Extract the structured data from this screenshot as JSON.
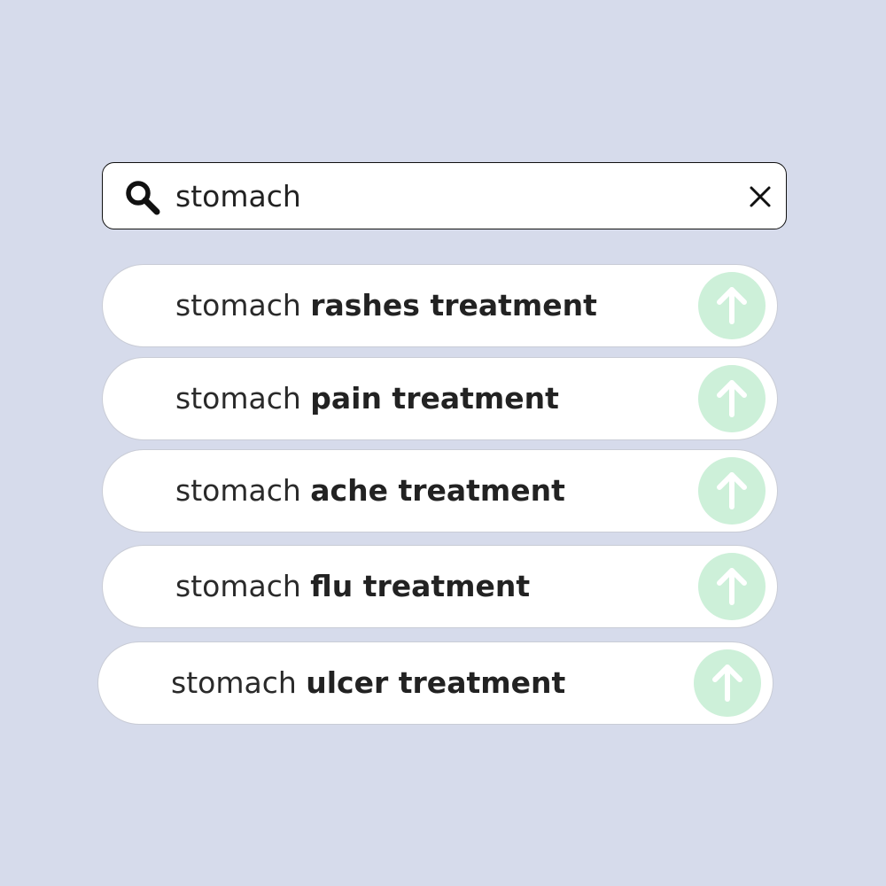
{
  "search": {
    "query": "stomach",
    "icon": "search-icon",
    "clear_icon": "close-icon"
  },
  "suggestions": [
    {
      "query": "stomach",
      "completion": "rashes treatment"
    },
    {
      "query": "stomach",
      "completion": "pain treatment"
    },
    {
      "query": "stomach",
      "completion": "ache treatment"
    },
    {
      "query": "stomach",
      "completion": "flu treatment"
    },
    {
      "query": "stomach",
      "completion": "ulcer treatment"
    }
  ],
  "colors": {
    "background": "#d6dbeb",
    "suggestion_button": "#cdf0d9",
    "text": "#222222"
  }
}
